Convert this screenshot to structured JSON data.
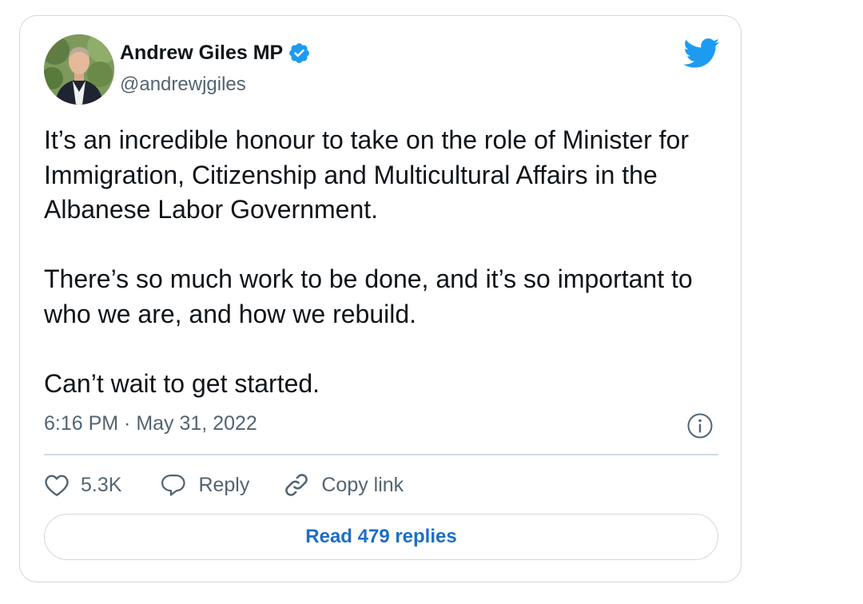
{
  "author": {
    "name": "Andrew Giles MP",
    "handle": "@andrewjgiles",
    "verified": true,
    "avatar_icon": "profile-photo"
  },
  "brand": {
    "logo_icon": "twitter-bird-icon",
    "accent_color": "#1d9bf0"
  },
  "tweet": {
    "paragraphs": [
      "It’s an incredible honour to take on the role of Minister for Immigration, Citizenship and Multicultural Affairs in the Albanese Labor Government.",
      "There’s so much work to be done, and it’s so important to who we are, and how we rebuild.",
      "Can’t wait to get started."
    ],
    "timestamp": "6:16 PM · May 31, 2022"
  },
  "actions": {
    "like_count": "5.3K",
    "reply_label": "Reply",
    "copy_link_label": "Copy link"
  },
  "replies_button_label": "Read 479 replies"
}
